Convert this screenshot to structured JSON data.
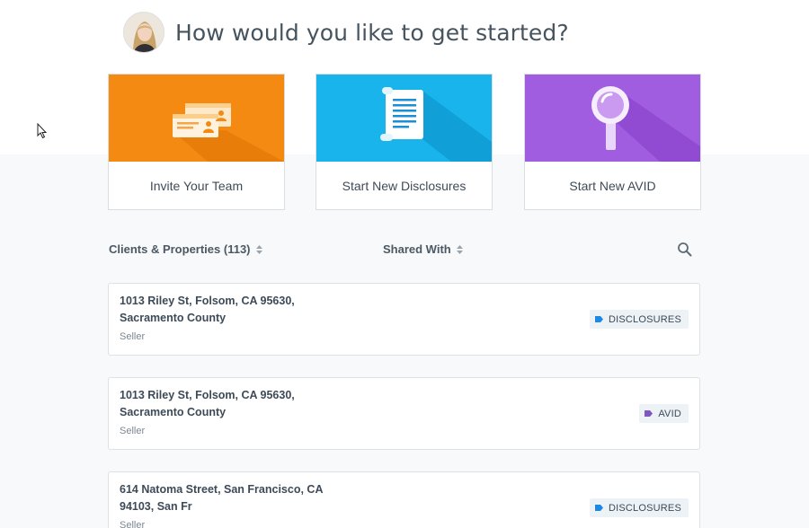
{
  "header": {
    "title": "How would you like to get started?"
  },
  "cards": [
    {
      "label": "Invite Your Team",
      "icon": "id-cards-icon",
      "color": "#f58a12"
    },
    {
      "label": "Start New Disclosures",
      "icon": "document-scroll-icon",
      "color": "#19b4ec"
    },
    {
      "label": "Start New AVID",
      "icon": "magnifier-icon",
      "color": "#a15de0"
    }
  ],
  "list": {
    "clients_header": "Clients & Properties (113)",
    "shared_header": "Shared With",
    "rows": [
      {
        "address_line1": "1013 Riley St, Folsom, CA 95630,",
        "address_line2": "Sacramento County",
        "role": "Seller",
        "badge": "DISCLOSURES",
        "badge_color": "#1e88e5"
      },
      {
        "address_line1": "1013 Riley St, Folsom, CA 95630,",
        "address_line2": "Sacramento County",
        "role": "Seller",
        "badge": "AVID",
        "badge_color": "#7e57c2"
      },
      {
        "address_line1": "614 Natoma Street, San Francisco, CA",
        "address_line2": "94103, San Fr",
        "role": "Seller",
        "badge": "DISCLOSURES",
        "badge_color": "#1e88e5"
      }
    ]
  }
}
